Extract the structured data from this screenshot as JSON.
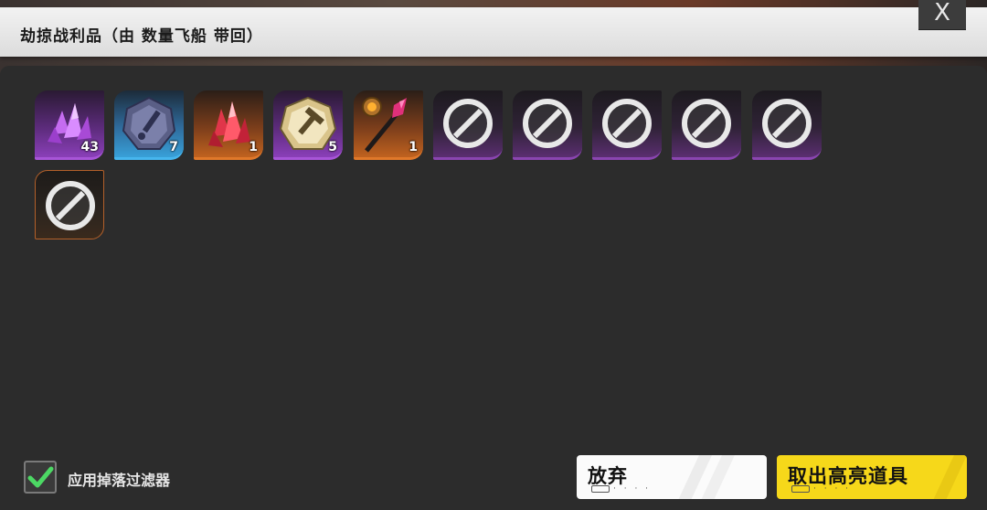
{
  "dialog": {
    "title": "劫掠战利品（由 数量飞船 带回）",
    "close_label": "X"
  },
  "loot": {
    "items": [
      {
        "icon": "purple-crystal-cluster-icon",
        "rarity": "purple",
        "count": "43"
      },
      {
        "icon": "blue-gear-dagger-emblem-icon",
        "rarity": "blue",
        "count": "7"
      },
      {
        "icon": "red-crystal-icon",
        "rarity": "orange",
        "count": "1"
      },
      {
        "icon": "gold-hammer-emblem-icon",
        "rarity": "purple",
        "count": "5"
      },
      {
        "icon": "crystal-scepter-icon",
        "rarity": "orange",
        "count": "1"
      },
      {
        "icon": "blocked-icon",
        "rarity": "dark-purple",
        "count": ""
      },
      {
        "icon": "blocked-icon",
        "rarity": "dark-purple",
        "count": ""
      },
      {
        "icon": "blocked-icon",
        "rarity": "dark-purple",
        "count": ""
      },
      {
        "icon": "blocked-icon",
        "rarity": "dark-purple",
        "count": ""
      },
      {
        "icon": "blocked-icon",
        "rarity": "dark-purple",
        "count": ""
      },
      {
        "icon": "blocked-icon",
        "rarity": "dark-orange",
        "count": ""
      }
    ]
  },
  "footer": {
    "filter_label": "应用掉落过滤器",
    "filter_checked": true,
    "abandon_label": "放弃",
    "take_label": "取出高亮道具",
    "hint_dots": "· · · ·"
  },
  "colors": {
    "accent_yellow": "#f6d81a",
    "check_green": "#4cd964",
    "purple_rarity": "#a855d8",
    "blue_rarity": "#46b6ee",
    "orange_rarity": "#e0782a"
  }
}
